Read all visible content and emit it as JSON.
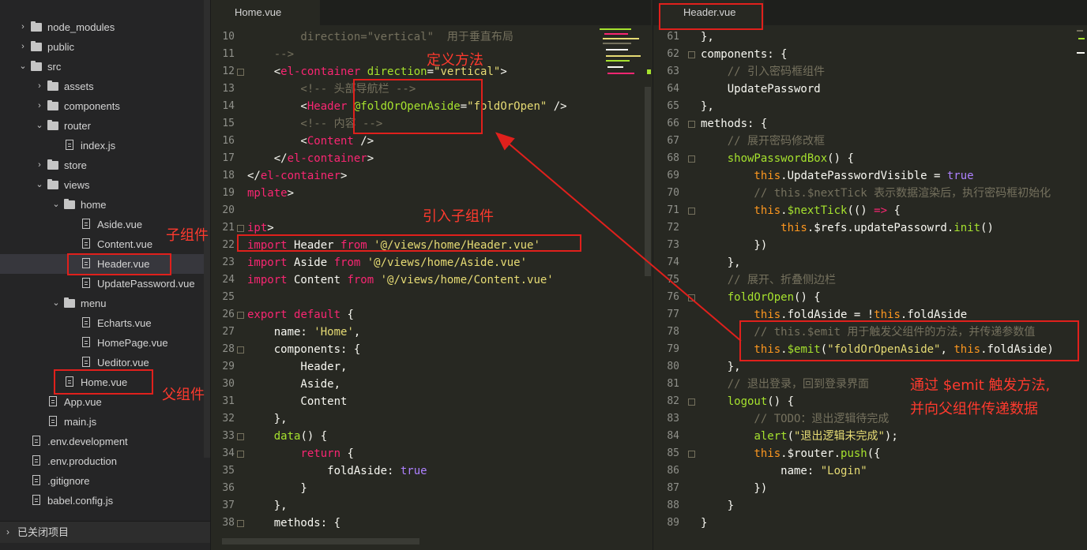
{
  "sidebar": {
    "items": [
      {
        "label": "node_modules",
        "type": "folder",
        "chev": "›",
        "depth": 1
      },
      {
        "label": "public",
        "type": "folder",
        "chev": "›",
        "depth": 1
      },
      {
        "label": "src",
        "type": "folder",
        "chev": "⌄",
        "depth": 1
      },
      {
        "label": "assets",
        "type": "folder",
        "chev": "›",
        "depth": 2
      },
      {
        "label": "components",
        "type": "folder",
        "chev": "›",
        "depth": 2
      },
      {
        "label": "router",
        "type": "folder",
        "chev": "⌄",
        "depth": 2
      },
      {
        "label": "index.js",
        "type": "file",
        "chev": "",
        "depth": 3
      },
      {
        "label": "store",
        "type": "folder",
        "chev": "›",
        "depth": 2
      },
      {
        "label": "views",
        "type": "folder",
        "chev": "⌄",
        "depth": 2
      },
      {
        "label": "home",
        "type": "folder",
        "chev": "⌄",
        "depth": 3
      },
      {
        "label": "Aside.vue",
        "type": "file",
        "chev": "",
        "depth": 4
      },
      {
        "label": "Content.vue",
        "type": "file",
        "chev": "",
        "depth": 4
      },
      {
        "label": "Header.vue",
        "type": "file",
        "chev": "",
        "depth": 4,
        "selected": true
      },
      {
        "label": "UpdatePassword.vue",
        "type": "file",
        "chev": "",
        "depth": 4
      },
      {
        "label": "menu",
        "type": "folder",
        "chev": "⌄",
        "depth": 3
      },
      {
        "label": "Echarts.vue",
        "type": "file",
        "chev": "",
        "depth": 4
      },
      {
        "label": "HomePage.vue",
        "type": "file",
        "chev": "",
        "depth": 4
      },
      {
        "label": "Ueditor.vue",
        "type": "file",
        "chev": "",
        "depth": 4
      },
      {
        "label": "Home.vue",
        "type": "file",
        "chev": "",
        "depth": 3
      },
      {
        "label": "App.vue",
        "type": "file",
        "chev": "",
        "depth": 2
      },
      {
        "label": "main.js",
        "type": "file",
        "chev": "",
        "depth": 2
      },
      {
        "label": ".env.development",
        "type": "file",
        "chev": "",
        "depth": 1
      },
      {
        "label": ".env.production",
        "type": "file",
        "chev": "",
        "depth": 1
      },
      {
        "label": ".gitignore",
        "type": "file",
        "chev": "",
        "depth": 1
      },
      {
        "label": "babel.config.js",
        "type": "file",
        "chev": "",
        "depth": 1
      }
    ],
    "closed_projects": "已关闭项目"
  },
  "left_editor": {
    "tab": "Home.vue",
    "lines": [
      {
        "n": "10",
        "fold": false,
        "tokens": [
          [
            "cm",
            "        direction=\"vertical\"  用于垂直布局"
          ]
        ]
      },
      {
        "n": "11",
        "fold": false,
        "tokens": [
          [
            "cm",
            "    -->"
          ]
        ]
      },
      {
        "n": "12",
        "fold": true,
        "tokens": [
          [
            "pl",
            "    <"
          ],
          [
            "tag",
            "el-container"
          ],
          [
            "pl",
            " "
          ],
          [
            "at",
            "direction"
          ],
          [
            "pl",
            "="
          ],
          [
            "str",
            "\"vertical\""
          ],
          [
            "pl",
            ">"
          ]
        ]
      },
      {
        "n": "13",
        "fold": false,
        "tokens": [
          [
            "cm",
            "        <!-- 头部导航栏 -->"
          ]
        ]
      },
      {
        "n": "14",
        "fold": false,
        "tokens": [
          [
            "pl",
            "        <"
          ],
          [
            "tag",
            "Header"
          ],
          [
            "pl",
            " "
          ],
          [
            "at",
            "@foldOrOpenAside"
          ],
          [
            "pl",
            "="
          ],
          [
            "str",
            "\"foldOrOpen\""
          ],
          [
            "pl",
            " />"
          ]
        ]
      },
      {
        "n": "15",
        "fold": false,
        "tokens": [
          [
            "cm",
            "        <!-- 内容 -->"
          ]
        ]
      },
      {
        "n": "16",
        "fold": false,
        "tokens": [
          [
            "pl",
            "        <"
          ],
          [
            "tag",
            "Content"
          ],
          [
            "pl",
            " />"
          ]
        ]
      },
      {
        "n": "17",
        "fold": false,
        "tokens": [
          [
            "pl",
            "    </"
          ],
          [
            "tag",
            "el-container"
          ],
          [
            "pl",
            ">"
          ]
        ]
      },
      {
        "n": "18",
        "fold": false,
        "tokens": [
          [
            "pl",
            "</"
          ],
          [
            "tag",
            "el-container"
          ],
          [
            "pl",
            ">"
          ]
        ]
      },
      {
        "n": "19",
        "fold": false,
        "tokens": [
          [
            "tag",
            "mplate"
          ],
          [
            "pl",
            ">"
          ]
        ]
      },
      {
        "n": "20",
        "fold": false,
        "tokens": [
          [
            "pl",
            ""
          ]
        ]
      },
      {
        "n": "21",
        "fold": true,
        "tokens": [
          [
            "tag",
            "ipt"
          ],
          [
            "pl",
            ">"
          ]
        ]
      },
      {
        "n": "22",
        "fold": false,
        "tokens": [
          [
            "kw",
            "import"
          ],
          [
            "pl",
            " Header "
          ],
          [
            "kw",
            "from"
          ],
          [
            "pl",
            " "
          ],
          [
            "str",
            "'@/views/home/Header.vue'"
          ]
        ]
      },
      {
        "n": "23",
        "fold": false,
        "tokens": [
          [
            "kw",
            "import"
          ],
          [
            "pl",
            " Aside "
          ],
          [
            "kw",
            "from"
          ],
          [
            "pl",
            " "
          ],
          [
            "str",
            "'@/views/home/Aside.vue'"
          ]
        ]
      },
      {
        "n": "24",
        "fold": false,
        "tokens": [
          [
            "kw",
            "import"
          ],
          [
            "pl",
            " Content "
          ],
          [
            "kw",
            "from"
          ],
          [
            "pl",
            " "
          ],
          [
            "str",
            "'@/views/home/Content.vue'"
          ]
        ]
      },
      {
        "n": "25",
        "fold": false,
        "tokens": [
          [
            "pl",
            ""
          ]
        ]
      },
      {
        "n": "26",
        "fold": true,
        "tokens": [
          [
            "kw",
            "export"
          ],
          [
            "pl",
            " "
          ],
          [
            "kw",
            "default"
          ],
          [
            "pl",
            " {"
          ]
        ]
      },
      {
        "n": "27",
        "fold": false,
        "tokens": [
          [
            "pl",
            "    name: "
          ],
          [
            "str",
            "'Home'"
          ],
          [
            "pl",
            ","
          ]
        ]
      },
      {
        "n": "28",
        "fold": true,
        "tokens": [
          [
            "pl",
            "    components: {"
          ]
        ]
      },
      {
        "n": "29",
        "fold": false,
        "tokens": [
          [
            "pl",
            "        Header,"
          ]
        ]
      },
      {
        "n": "30",
        "fold": false,
        "tokens": [
          [
            "pl",
            "        Aside,"
          ]
        ]
      },
      {
        "n": "31",
        "fold": false,
        "tokens": [
          [
            "pl",
            "        Content"
          ]
        ]
      },
      {
        "n": "32",
        "fold": false,
        "tokens": [
          [
            "pl",
            "    },"
          ]
        ]
      },
      {
        "n": "33",
        "fold": true,
        "tokens": [
          [
            "pl",
            "    "
          ],
          [
            "fn",
            "data"
          ],
          [
            "pl",
            "() {"
          ]
        ]
      },
      {
        "n": "34",
        "fold": true,
        "tokens": [
          [
            "pl",
            "        "
          ],
          [
            "kw",
            "return"
          ],
          [
            "pl",
            " {"
          ]
        ]
      },
      {
        "n": "35",
        "fold": false,
        "tokens": [
          [
            "pl",
            "            foldAside: "
          ],
          [
            "bool",
            "true"
          ]
        ]
      },
      {
        "n": "36",
        "fold": false,
        "tokens": [
          [
            "pl",
            "        }"
          ]
        ]
      },
      {
        "n": "37",
        "fold": false,
        "tokens": [
          [
            "pl",
            "    },"
          ]
        ]
      },
      {
        "n": "38",
        "fold": true,
        "tokens": [
          [
            "pl",
            "    methods: {"
          ]
        ]
      }
    ]
  },
  "right_editor": {
    "tab": "Header.vue",
    "lines": [
      {
        "n": "61",
        "fold": false,
        "tokens": [
          [
            "pl",
            "},"
          ]
        ]
      },
      {
        "n": "62",
        "fold": true,
        "tokens": [
          [
            "pl",
            "components: {"
          ]
        ]
      },
      {
        "n": "63",
        "fold": false,
        "tokens": [
          [
            "cm",
            "    // 引入密码框组件"
          ]
        ]
      },
      {
        "n": "64",
        "fold": false,
        "tokens": [
          [
            "pl",
            "    UpdatePassword"
          ]
        ]
      },
      {
        "n": "65",
        "fold": false,
        "tokens": [
          [
            "pl",
            "},"
          ]
        ]
      },
      {
        "n": "66",
        "fold": true,
        "tokens": [
          [
            "pl",
            "methods: {"
          ]
        ]
      },
      {
        "n": "67",
        "fold": false,
        "tokens": [
          [
            "cm",
            "    // 展开密码修改框"
          ]
        ]
      },
      {
        "n": "68",
        "fold": true,
        "tokens": [
          [
            "pl",
            "    "
          ],
          [
            "fn",
            "showPasswordBox"
          ],
          [
            "pl",
            "() {"
          ]
        ]
      },
      {
        "n": "69",
        "fold": false,
        "tokens": [
          [
            "th",
            "        this"
          ],
          [
            "pl",
            ".UpdatePasswordVisible = "
          ],
          [
            "bool",
            "true"
          ]
        ]
      },
      {
        "n": "70",
        "fold": false,
        "tokens": [
          [
            "cm",
            "        // this.$nextTick 表示数据渲染后，执行密码框初始化"
          ]
        ]
      },
      {
        "n": "71",
        "fold": true,
        "tokens": [
          [
            "th",
            "        this"
          ],
          [
            "pl",
            "."
          ],
          [
            "fn",
            "$nextTick"
          ],
          [
            "pl",
            "(() "
          ],
          [
            "kw",
            "=>"
          ],
          [
            "pl",
            " {"
          ]
        ]
      },
      {
        "n": "72",
        "fold": false,
        "tokens": [
          [
            "th",
            "            this"
          ],
          [
            "pl",
            ".$refs.updatePassowrd."
          ],
          [
            "fn",
            "init"
          ],
          [
            "pl",
            "()"
          ]
        ]
      },
      {
        "n": "73",
        "fold": false,
        "tokens": [
          [
            "pl",
            "        })"
          ]
        ]
      },
      {
        "n": "74",
        "fold": false,
        "tokens": [
          [
            "pl",
            "    },"
          ]
        ]
      },
      {
        "n": "75",
        "fold": false,
        "tokens": [
          [
            "cm",
            "    // 展开、折叠侧边栏"
          ]
        ]
      },
      {
        "n": "76",
        "fold": true,
        "tokens": [
          [
            "pl",
            "    "
          ],
          [
            "fn",
            "foldOrOpen"
          ],
          [
            "pl",
            "() {"
          ]
        ]
      },
      {
        "n": "77",
        "fold": false,
        "tokens": [
          [
            "th",
            "        this"
          ],
          [
            "pl",
            ".foldAside = !"
          ],
          [
            "th",
            "this"
          ],
          [
            "pl",
            ".foldAside"
          ]
        ]
      },
      {
        "n": "78",
        "fold": false,
        "tokens": [
          [
            "cm",
            "        // this.$emit 用于触发父组件的方法，并传递参数值"
          ]
        ]
      },
      {
        "n": "79",
        "fold": false,
        "tokens": [
          [
            "th",
            "        this"
          ],
          [
            "pl",
            "."
          ],
          [
            "fn",
            "$emit"
          ],
          [
            "pl",
            "("
          ],
          [
            "str",
            "\"foldOrOpenAside\""
          ],
          [
            "pl",
            ", "
          ],
          [
            "th",
            "this"
          ],
          [
            "pl",
            ".foldAside)"
          ]
        ]
      },
      {
        "n": "80",
        "fold": false,
        "tokens": [
          [
            "pl",
            "    },"
          ]
        ]
      },
      {
        "n": "81",
        "fold": false,
        "tokens": [
          [
            "cm",
            "    // 退出登录，回到登录界面"
          ]
        ]
      },
      {
        "n": "82",
        "fold": true,
        "tokens": [
          [
            "pl",
            "    "
          ],
          [
            "fn",
            "logout"
          ],
          [
            "pl",
            "() {"
          ]
        ]
      },
      {
        "n": "83",
        "fold": false,
        "tokens": [
          [
            "cm",
            "        // TODO：退出逻辑待完成"
          ]
        ]
      },
      {
        "n": "84",
        "fold": false,
        "tokens": [
          [
            "pl",
            "        "
          ],
          [
            "fn",
            "alert"
          ],
          [
            "pl",
            "("
          ],
          [
            "str",
            "\"退出逻辑未完成\""
          ],
          [
            "pl",
            ");"
          ]
        ]
      },
      {
        "n": "85",
        "fold": true,
        "tokens": [
          [
            "th",
            "        this"
          ],
          [
            "pl",
            ".$router."
          ],
          [
            "fn",
            "push"
          ],
          [
            "pl",
            "({"
          ]
        ]
      },
      {
        "n": "86",
        "fold": false,
        "tokens": [
          [
            "pl",
            "            name: "
          ],
          [
            "str",
            "\"Login\""
          ]
        ]
      },
      {
        "n": "87",
        "fold": false,
        "tokens": [
          [
            "pl",
            "        })"
          ]
        ]
      },
      {
        "n": "88",
        "fold": false,
        "tokens": [
          [
            "pl",
            "    }"
          ]
        ]
      },
      {
        "n": "89",
        "fold": false,
        "tokens": [
          [
            "pl",
            "}"
          ]
        ]
      }
    ]
  },
  "annotations": {
    "define_method": "定义方法",
    "import_child": "引入子组件",
    "child_component": "子组件",
    "parent_component": "父组件",
    "emit_line1": "通过 $emit 触发方法,",
    "emit_line2": "并向父组件传递数据"
  },
  "colors": {
    "annotation": "#ff3a2e",
    "editor_bg": "#272822",
    "sidebar_bg": "#252526"
  }
}
